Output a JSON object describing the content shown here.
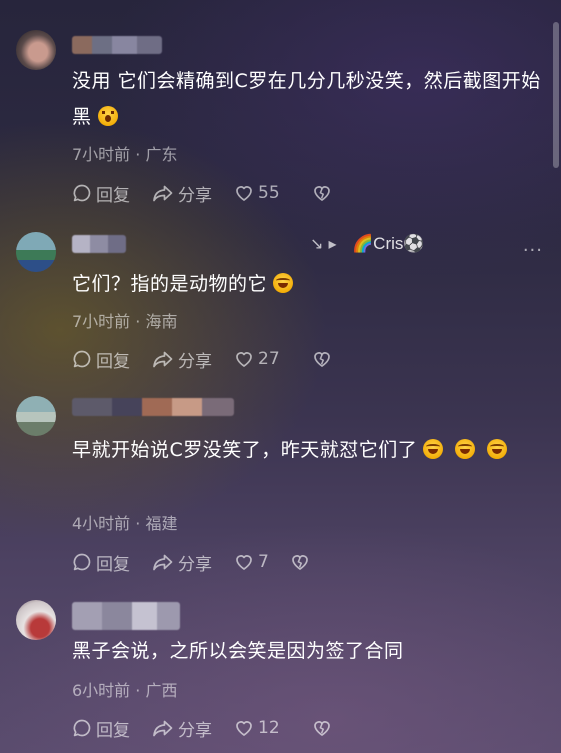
{
  "comments": [
    {
      "text": "没用 它们会精确到C罗在几分几秒没笑，然后截图开始黑",
      "emoji": "astonished-face",
      "time_location": "7小时前 · 广东",
      "reply_label": "回复",
      "share_label": "分享",
      "likes": "55"
    },
    {
      "reply_to_name": "🌈Cris⚽",
      "text": "它们？指的是动物的它",
      "emoji": "rofl-face",
      "time_location": "7小时前 · 海南",
      "reply_label": "回复",
      "share_label": "分享",
      "likes": "27"
    },
    {
      "text": "早就开始说C罗没笑了，昨天就怼它们了",
      "emoji": "rofl-face",
      "time_location": "4小时前 · 福建",
      "reply_label": "回复",
      "share_label": "分享",
      "likes": "7"
    },
    {
      "text": "黑子会说，之所以会笑是因为签了合同",
      "time_location": "6小时前 · 广西",
      "reply_label": "回复",
      "share_label": "分享",
      "likes": "12"
    }
  ],
  "icons": {
    "reply": "comment-bubble-icon",
    "share": "share-arrow-icon",
    "like": "heart-outline-icon",
    "dislike": "broken-heart-icon",
    "more": "more-dots-icon"
  }
}
